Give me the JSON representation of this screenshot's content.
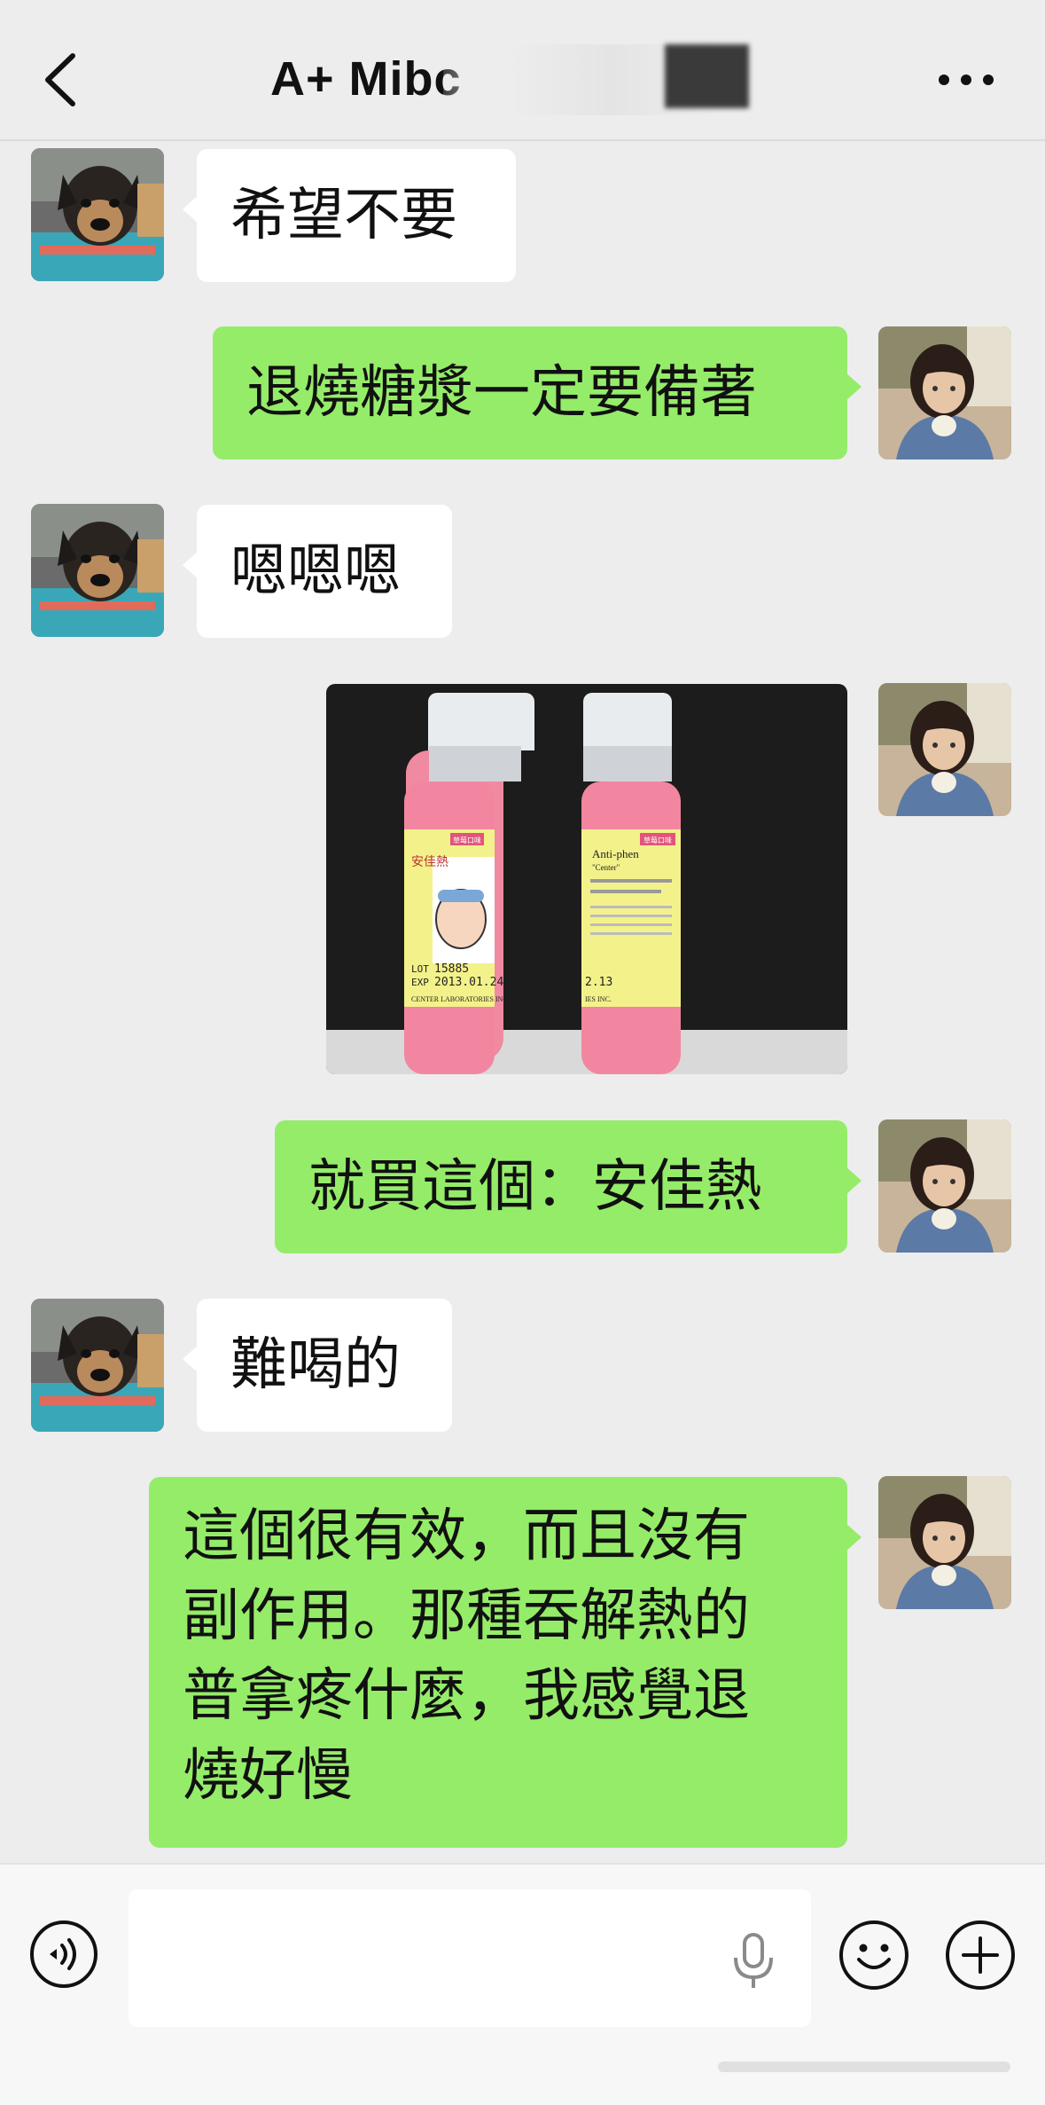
{
  "header": {
    "title": "A+ Mibc"
  },
  "messages": [
    {
      "side": "left",
      "text": "希望不要"
    },
    {
      "side": "right",
      "text": "退燒糖漿一定要備著"
    },
    {
      "side": "left",
      "text": "嗯嗯嗯"
    },
    {
      "side": "right",
      "type": "image",
      "image": {
        "bottle_left": {
          "badge": "草莓口味",
          "brand": "安佳熱",
          "lot_label": "LOT",
          "lot": "15885",
          "exp_label": "EXP",
          "exp": "2013.01.24",
          "maker": "CENTER LABORATORIES INC."
        },
        "bottle_right": {
          "badge": "草莓口味",
          "name_en": "Anti-phen",
          "sub_en": "\"Center\"",
          "exp_partial": "2.13",
          "maker_partial": "IES INC."
        }
      }
    },
    {
      "side": "right",
      "text": "就買這個：安佳熱"
    },
    {
      "side": "left",
      "text": "難喝的"
    },
    {
      "side": "right",
      "lines": [
        "這個很有效，而且沒有",
        "副作用。那種吞解熱的",
        "普拿疼什麼，我感覺退",
        "燒好慢"
      ]
    }
  ],
  "colors": {
    "background": "#ededed",
    "bubble_self": "#95ec69",
    "bubble_other": "#ffffff"
  },
  "icons": {
    "back": "chevron-left-icon",
    "more": "more-dots-icon",
    "voice": "voice-mode-icon",
    "mic": "microphone-icon",
    "emoji": "emoji-icon",
    "plus": "plus-icon"
  }
}
